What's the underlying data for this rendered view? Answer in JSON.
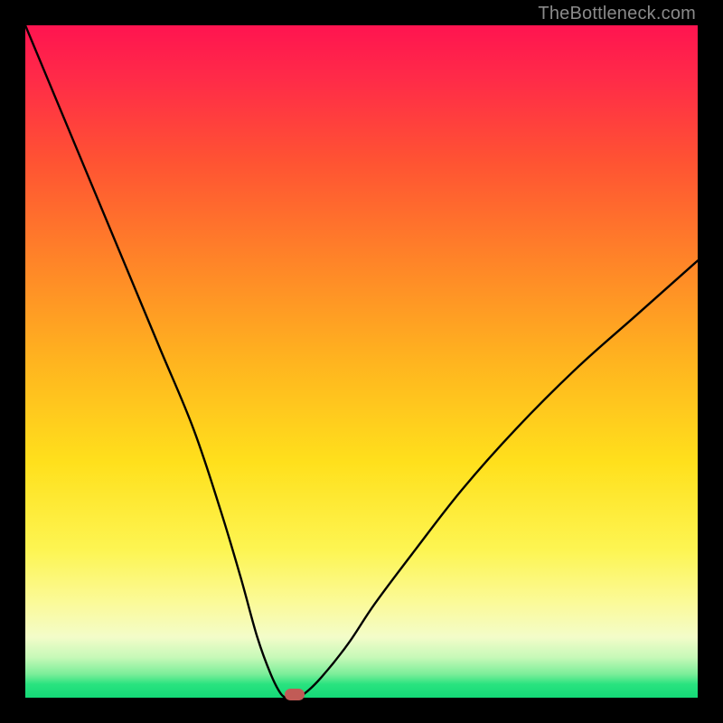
{
  "watermark": "TheBottleneck.com",
  "chart_data": {
    "type": "line",
    "title": "",
    "xlabel": "",
    "ylabel": "",
    "xlim": [
      0,
      100
    ],
    "ylim": [
      0,
      100
    ],
    "series": [
      {
        "name": "bottleneck-curve",
        "x": [
          0,
          5,
          10,
          15,
          20,
          25,
          29,
          32,
          34.5,
          36.5,
          38,
          39,
          40,
          41.5,
          44,
          48,
          52,
          58,
          65,
          73,
          82,
          91,
          100
        ],
        "values": [
          100,
          88,
          76,
          64,
          52,
          40,
          28,
          18,
          9,
          3.5,
          0.6,
          0,
          0,
          0.6,
          3,
          8,
          14,
          22,
          31,
          40,
          49,
          57,
          65
        ]
      }
    ],
    "marker": {
      "x": 40,
      "y": 0
    },
    "colors": {
      "curve": "#000000",
      "marker": "#c15b56",
      "gradient_top": "#ff1450",
      "gradient_bottom": "#14d977"
    }
  }
}
